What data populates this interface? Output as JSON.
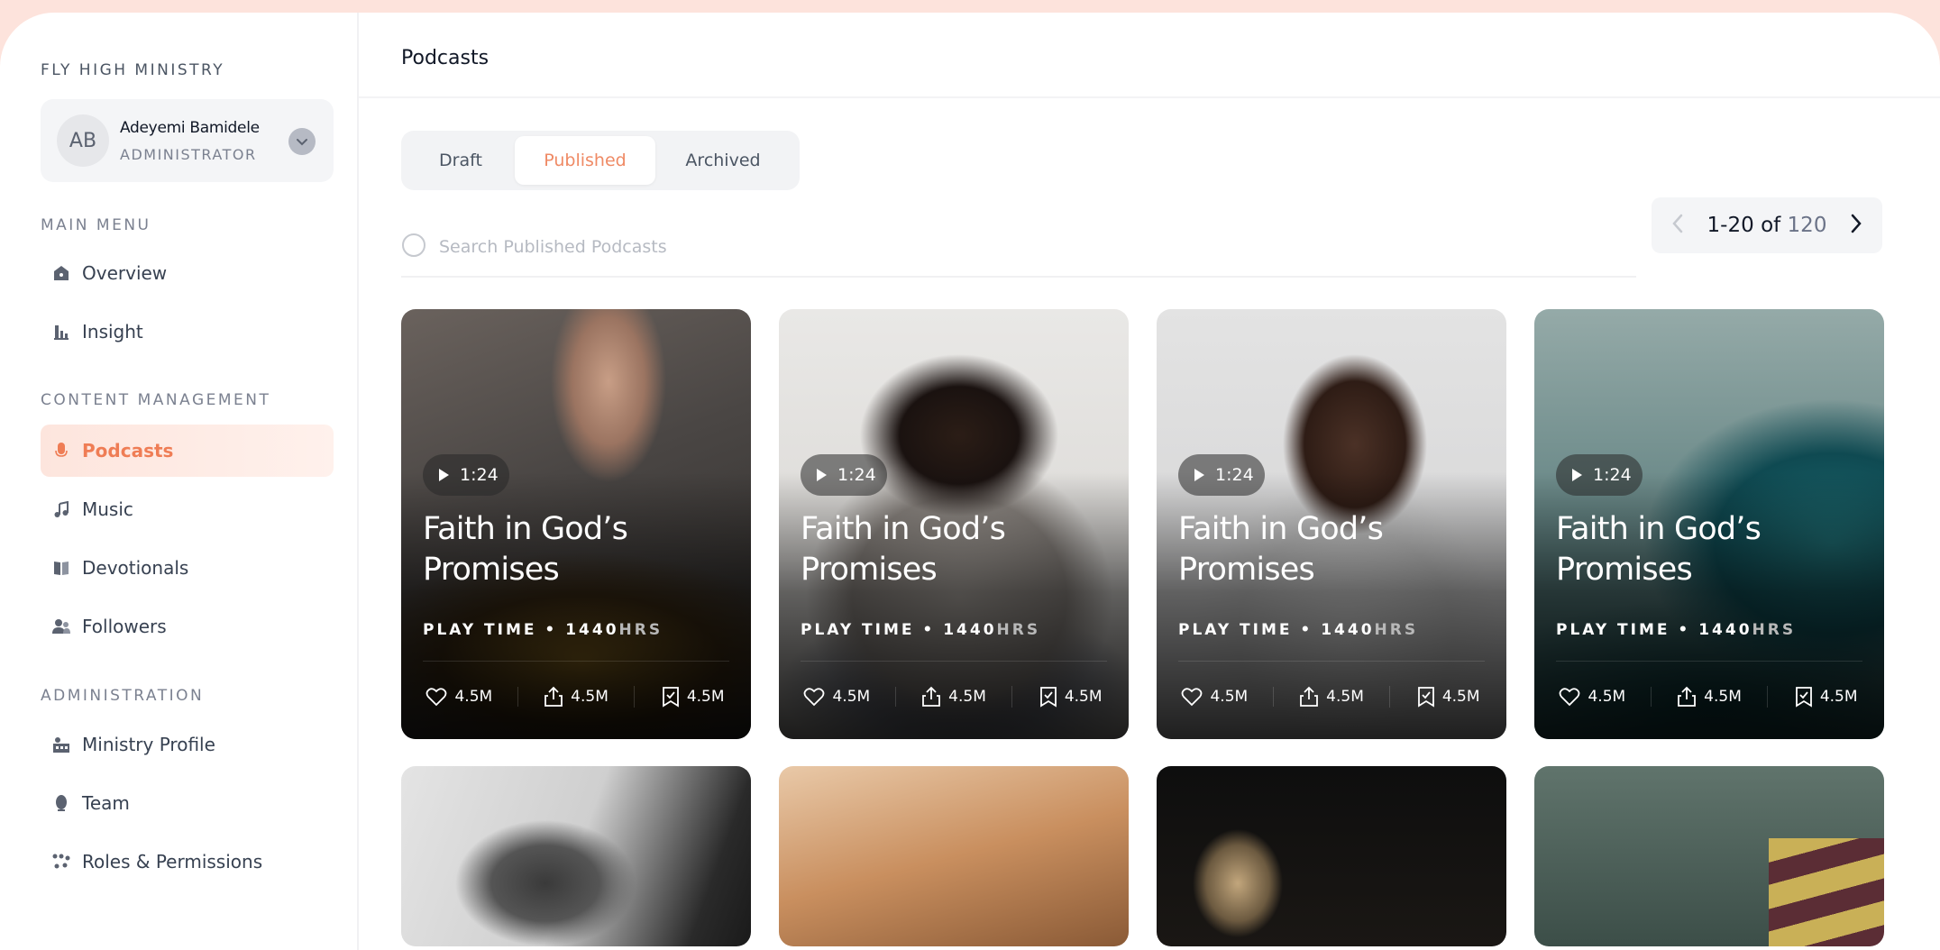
{
  "sidebar": {
    "org_name": "FLY HIGH MINISTRY",
    "user": {
      "initials": "AB",
      "name": "Adeyemi Bamidele",
      "role": "ADMINISTRATOR"
    },
    "sections": [
      {
        "label": "MAIN MENU",
        "items": [
          {
            "label": "Overview",
            "icon": "home-icon"
          },
          {
            "label": "Insight",
            "icon": "bar-chart-icon"
          }
        ]
      },
      {
        "label": "CONTENT MANAGEMENT",
        "items": [
          {
            "label": "Podcasts",
            "icon": "microphone-icon",
            "active": true
          },
          {
            "label": "Music",
            "icon": "music-note-icon"
          },
          {
            "label": "Devotionals",
            "icon": "book-icon"
          },
          {
            "label": "Followers",
            "icon": "users-icon"
          }
        ]
      },
      {
        "label": "ADMINISTRATION",
        "items": [
          {
            "label": "Ministry Profile",
            "icon": "building-icon"
          },
          {
            "label": "Team",
            "icon": "team-icon"
          },
          {
            "label": "Roles & Permissions",
            "icon": "permissions-icon"
          }
        ]
      }
    ]
  },
  "header": {
    "title": "Podcasts"
  },
  "tabs": [
    {
      "label": "Draft"
    },
    {
      "label": "Published",
      "active": true
    },
    {
      "label": "Archived"
    }
  ],
  "search": {
    "placeholder": "Search Published Podcasts",
    "value": ""
  },
  "pagination": {
    "range": "1-20",
    "of": "of",
    "total": "120"
  },
  "colors": {
    "accent": "#ef7d55",
    "active_bg": "#fde5dd"
  },
  "cards": [
    {
      "duration": "1:24",
      "title": "Faith in God’s Promises",
      "playtime_label": "PLAY TIME • 1440",
      "playtime_unit": "HRS",
      "likes": "4.5M",
      "shares": "4.5M",
      "saves": "4.5M"
    },
    {
      "duration": "1:24",
      "title": "Faith in God’s Promises",
      "playtime_label": "PLAY TIME • 1440",
      "playtime_unit": "HRS",
      "likes": "4.5M",
      "shares": "4.5M",
      "saves": "4.5M"
    },
    {
      "duration": "1:24",
      "title": "Faith in God’s Promises",
      "playtime_label": "PLAY TIME • 1440",
      "playtime_unit": "HRS",
      "likes": "4.5M",
      "shares": "4.5M",
      "saves": "4.5M"
    },
    {
      "duration": "1:24",
      "title": "Faith in God’s Promises",
      "playtime_label": "PLAY TIME • 1440",
      "playtime_unit": "HRS",
      "likes": "4.5M",
      "shares": "4.5M",
      "saves": "4.5M"
    }
  ]
}
